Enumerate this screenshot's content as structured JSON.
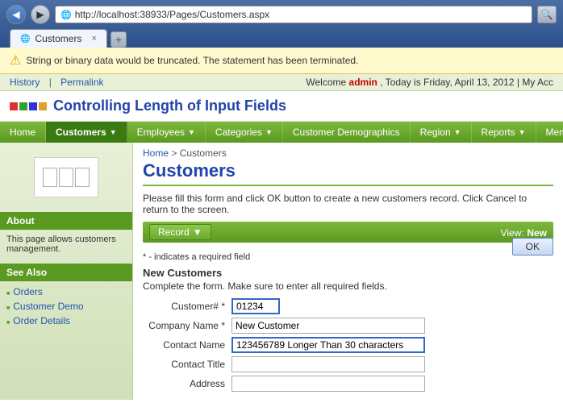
{
  "browser": {
    "back_btn": "◀",
    "forward_btn": "▶",
    "url": "http://localhost:38933/Pages/Customers.aspx",
    "search_icon": "🔍",
    "tab_favicon": "🌐",
    "tab_title": "Customers",
    "tab_close": "×"
  },
  "warning": {
    "icon": "⚠",
    "text": "String or binary data would be truncated. The statement has been terminated."
  },
  "history_bar": {
    "history": "History",
    "separator": "|",
    "permalink": "Permalink",
    "welcome": "Welcome",
    "admin": "admin",
    "today": ", Today is Friday, April 13, 2012 | My Acc"
  },
  "app_header": {
    "title": "Controlling Length of Input Fields"
  },
  "nav": {
    "items": [
      {
        "label": "Home",
        "active": false,
        "has_arrow": false
      },
      {
        "label": "Customers",
        "active": true,
        "has_arrow": true
      },
      {
        "label": "Employees",
        "active": false,
        "has_arrow": true
      },
      {
        "label": "Categories",
        "active": false,
        "has_arrow": true
      },
      {
        "label": "Customer Demographics",
        "active": false,
        "has_arrow": false
      },
      {
        "label": "Region",
        "active": false,
        "has_arrow": true
      },
      {
        "label": "Reports",
        "active": false,
        "has_arrow": true
      },
      {
        "label": "Membership",
        "active": false,
        "has_arrow": false
      }
    ]
  },
  "sidebar": {
    "about_heading": "About",
    "about_text": "This page allows customers management.",
    "see_also_heading": "See Also",
    "links": [
      {
        "label": "Orders"
      },
      {
        "label": "Customer Demo"
      },
      {
        "label": "Order Details"
      }
    ]
  },
  "main": {
    "breadcrumb_home": "Home",
    "breadcrumb_sep": " > ",
    "breadcrumb_current": "Customers",
    "page_title": "Customers",
    "instruction": "Please fill this form and click OK button to create a new customers record. Click Cancel to return to the screen.",
    "record_btn": "Record",
    "view_label": "View:",
    "view_value": "New",
    "ok_btn": "OK",
    "required_note": "* - indicates a required field",
    "form_title": "New Customers",
    "form_subtitle": "Complete the form. Make sure to enter all required fields.",
    "fields": [
      {
        "label": "Customer# *",
        "value": "01234",
        "type": "short",
        "error": true
      },
      {
        "label": "Company Name *",
        "value": "New Customer",
        "type": "medium",
        "error": false
      },
      {
        "label": "Contact Name",
        "value": "123456789 Longer Than 30 characters",
        "type": "long",
        "error": true,
        "selected_start": 9,
        "normal_part": "123456789 ",
        "selected_part": "Longer Than 30 characters"
      },
      {
        "label": "Contact Title",
        "value": "",
        "type": "medium",
        "error": false
      },
      {
        "label": "Address",
        "value": "",
        "type": "medium",
        "error": false
      }
    ]
  }
}
